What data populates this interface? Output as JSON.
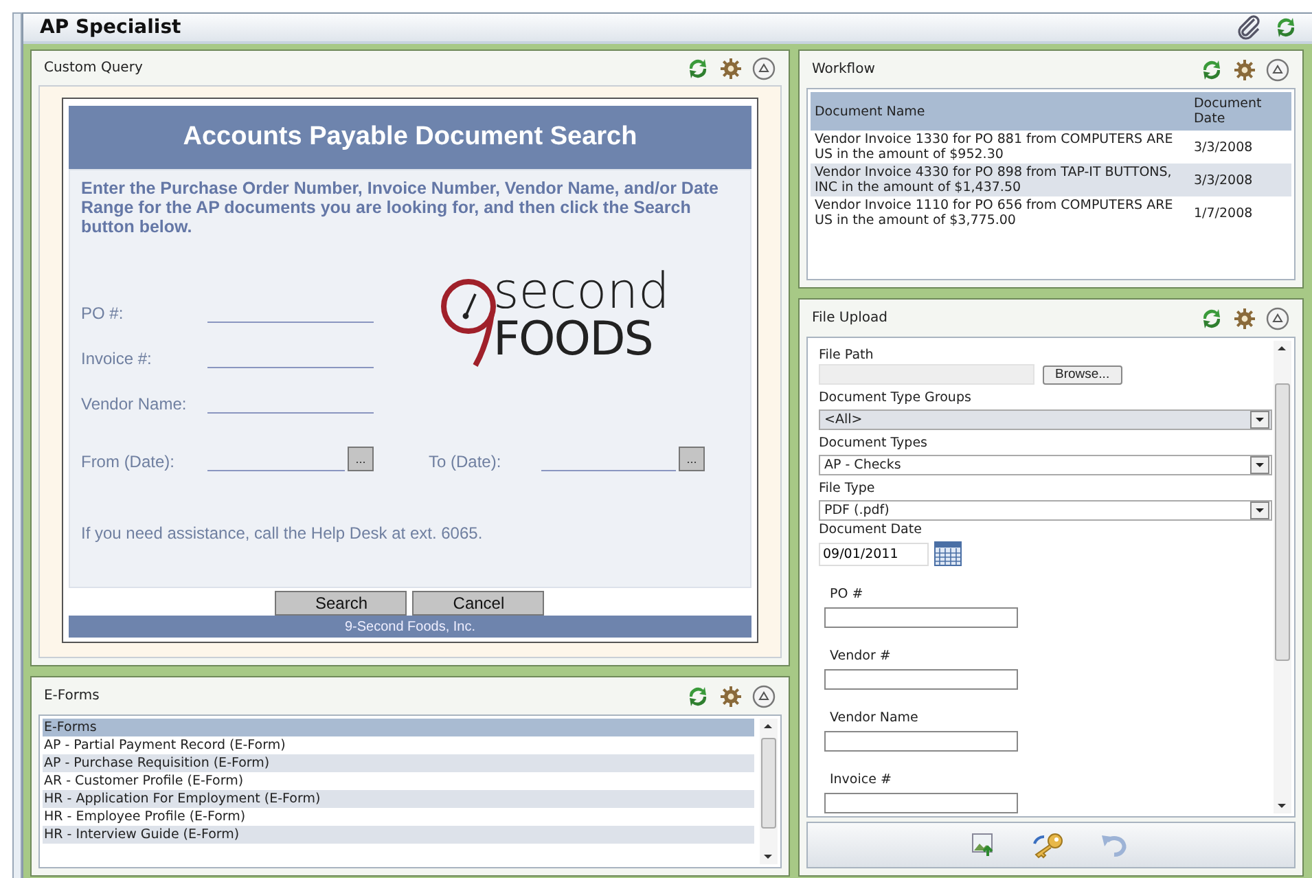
{
  "header": {
    "title": "AP Specialist"
  },
  "custom_query": {
    "title": "Custom Query",
    "form": {
      "heading": "Accounts Payable Document Search",
      "instructions": "Enter the Purchase Order Number, Invoice Number, Vendor Name, and/or Date Range for the AP documents you are looking for, and then click the Search button below.",
      "fields": [
        {
          "label": "PO #:"
        },
        {
          "label": "Invoice #:"
        },
        {
          "label": "Vendor Name:"
        }
      ],
      "date_range": [
        {
          "label": "From (Date):",
          "button": "..."
        },
        {
          "label": "To (Date):",
          "button": "..."
        }
      ],
      "logo": {
        "line1": "second",
        "line2": "FOODS"
      },
      "help_text": "If you need assistance, call the Help Desk at ext. 6065.",
      "buttons": [
        "Search",
        "Cancel"
      ],
      "footer": "9-Second Foods, Inc."
    }
  },
  "eforms": {
    "title": "E-Forms",
    "items": [
      {
        "label": "E-Forms",
        "selected": true
      },
      {
        "label": "AP - Partial Payment Record (E-Form)",
        "selected": false
      },
      {
        "label": "AP - Purchase Requisition (E-Form)",
        "selected": false
      },
      {
        "label": "AR - Customer Profile (E-Form)",
        "selected": false
      },
      {
        "label": "HR - Application For Employment (E-Form)",
        "selected": false
      },
      {
        "label": "HR - Employee Profile (E-Form)",
        "selected": false
      },
      {
        "label": "HR - Interview Guide (E-Form)",
        "selected": false
      }
    ]
  },
  "workflow": {
    "title": "Workflow",
    "columns": [
      "Document Name",
      "Document Date"
    ],
    "rows": [
      {
        "document_name": "Vendor Invoice 1330 for PO 881 from COMPUTERS ARE US in the amount of $952.30",
        "document_date": "3/3/2008"
      },
      {
        "document_name": "Vendor Invoice 4330 for PO 898 from TAP-IT BUTTONS, INC in the amount of $1,437.50",
        "document_date": "3/3/2008"
      },
      {
        "document_name": "Vendor Invoice 1110 for PO 656 from COMPUTERS ARE US in the amount of $3,775.00",
        "document_date": "1/7/2008"
      }
    ]
  },
  "file_upload": {
    "title": "File Upload",
    "fields": [
      {
        "kind": "file",
        "label": "File Path",
        "button": "Browse..."
      },
      {
        "kind": "select",
        "label": "Document Type Groups",
        "value": "<All>",
        "disabled": true
      },
      {
        "kind": "select",
        "label": "Document Types",
        "value": "AP - Checks",
        "disabled": false
      },
      {
        "kind": "select",
        "label": "File Type",
        "value": "PDF (.pdf)",
        "disabled": false
      },
      {
        "kind": "date",
        "label": "Document Date",
        "value": "09/01/2011"
      },
      {
        "kind": "text",
        "label": "PO #"
      },
      {
        "kind": "text",
        "label": "Vendor #"
      },
      {
        "kind": "text",
        "label": "Vendor Name"
      },
      {
        "kind": "text",
        "label": "Invoice #"
      }
    ]
  }
}
